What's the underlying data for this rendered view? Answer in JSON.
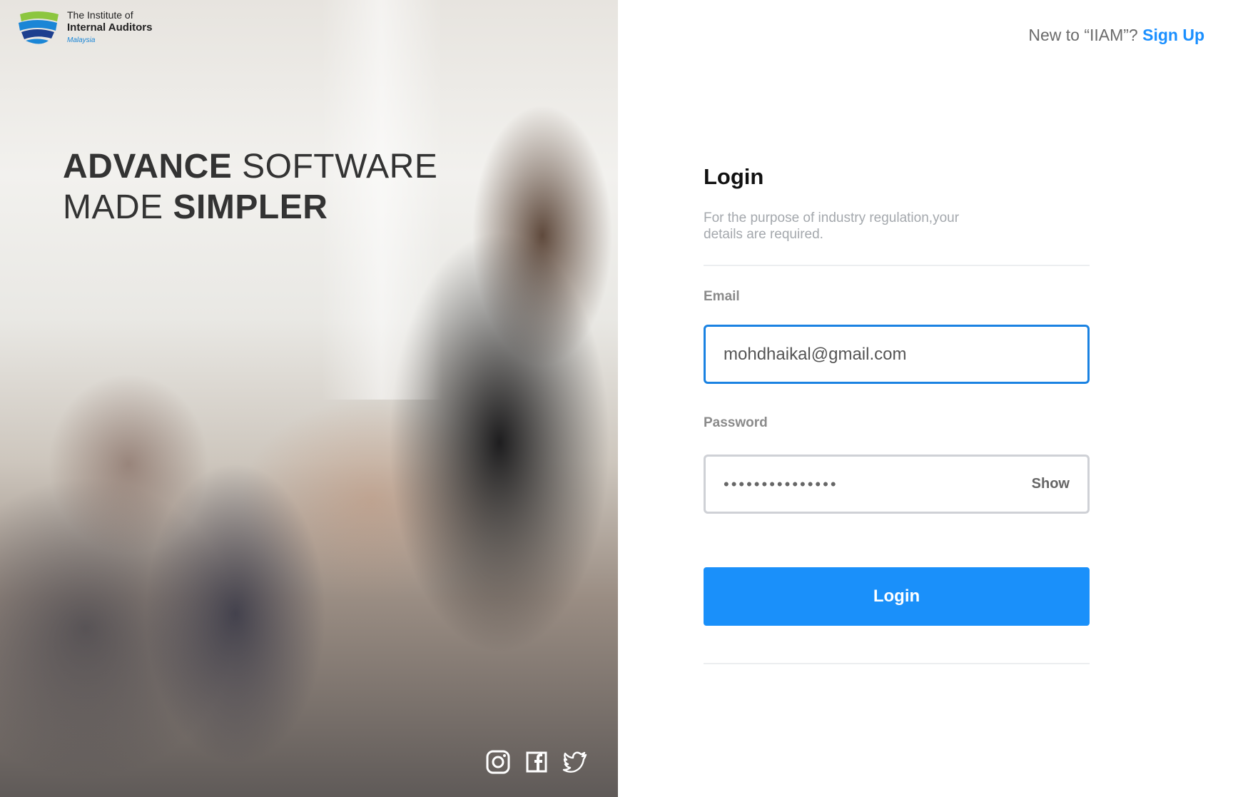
{
  "brand": {
    "line1": "The Institute of",
    "line2": "Internal Auditors",
    "line3": "Malaysia",
    "colors": {
      "green": "#8cc63f",
      "blue": "#1b86d6",
      "navy": "#1d3f8f"
    }
  },
  "hero": {
    "headline_part1_bold": "ADVANCE",
    "headline_part1_light": " SOFTWARE",
    "headline_part2_light": "MADE ",
    "headline_part2_bold": "SIMPLER"
  },
  "socials": [
    "instagram-icon",
    "facebook-icon",
    "twitter-icon"
  ],
  "topbar": {
    "prompt": "New to “IIAM”? ",
    "signup_label": "Sign Up"
  },
  "login": {
    "title": "Login",
    "subtitle": "For the purpose of industry regulation,your details are required.",
    "email_label": "Email",
    "email_value": "mohdhaikal@gmail.com",
    "password_label": "Password",
    "password_mask": "•••••••••••••••",
    "show_label": "Show",
    "button_label": "Login",
    "accent_color": "#1a90fa"
  }
}
